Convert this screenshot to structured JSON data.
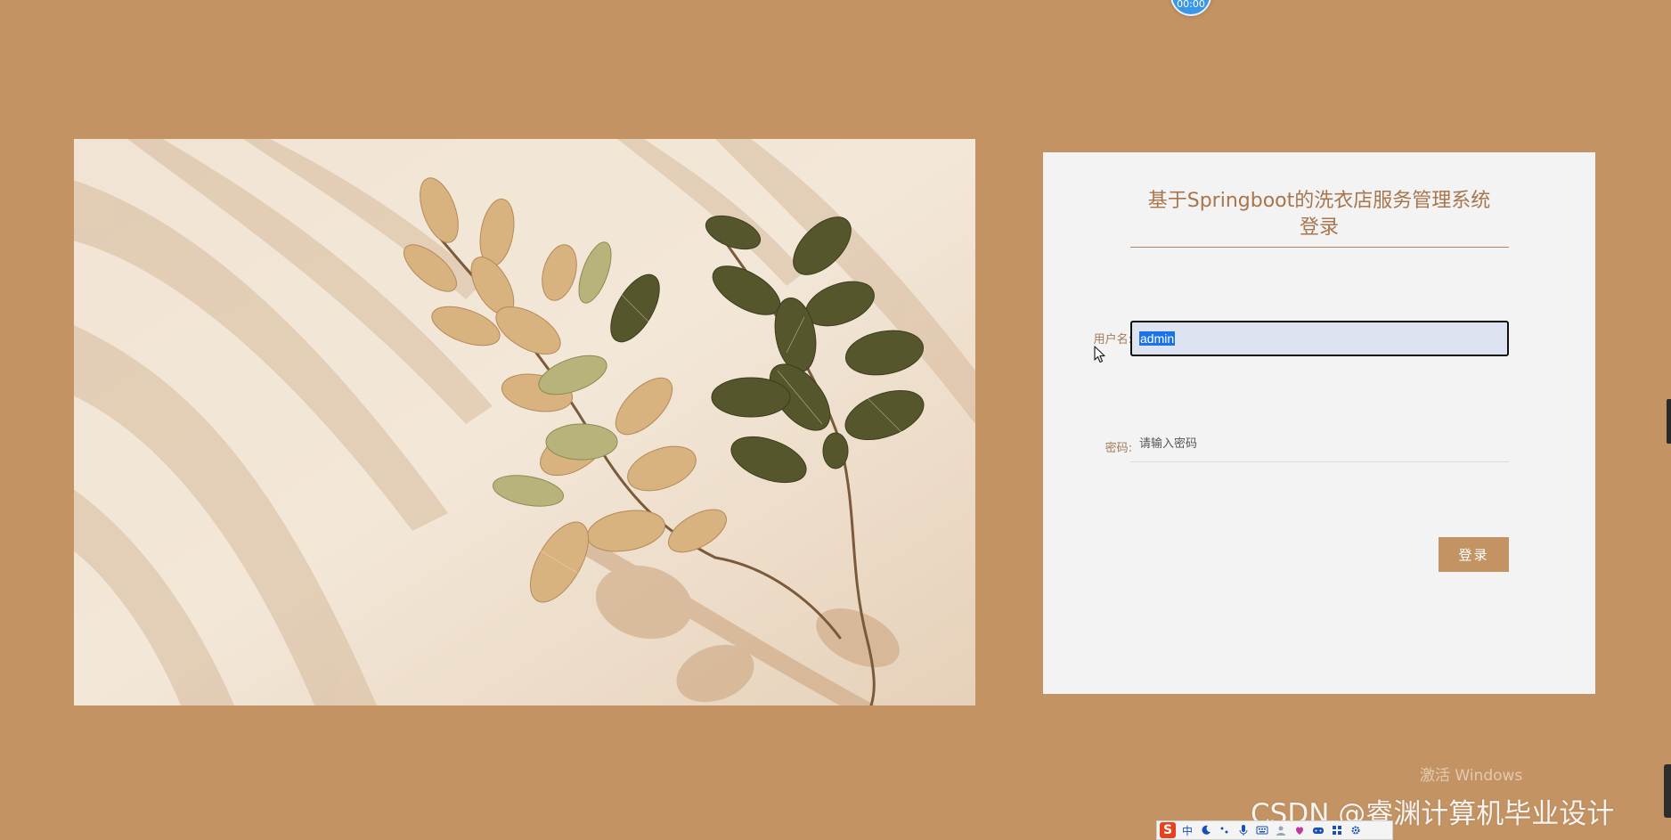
{
  "timer": {
    "label": "00:00"
  },
  "login": {
    "title_line1": "基于Springboot的洗衣店服务管理系统",
    "title_line2": "登录",
    "username_label": "用户名:",
    "username_value": "admin",
    "password_label": "密码:",
    "password_placeholder": "请输入密码",
    "submit_label": "登录"
  },
  "watermarks": {
    "activate_windows": "激活 Windows",
    "csdn": "CSDN @睿渊计算机毕业设计"
  },
  "ime_toolbar": {
    "logo": "S",
    "mode": "中",
    "items": [
      "moon-icon",
      "punctuation-icon",
      "microphone-icon",
      "keyboard-icon",
      "user-icon",
      "skin-icon",
      "game-icon",
      "grid-icon",
      "settings-icon"
    ]
  },
  "colors": {
    "background": "#c49363",
    "card": "#f3f3f3",
    "accent": "#c49363",
    "title": "#a8754c",
    "selection": "#1a73e8"
  }
}
